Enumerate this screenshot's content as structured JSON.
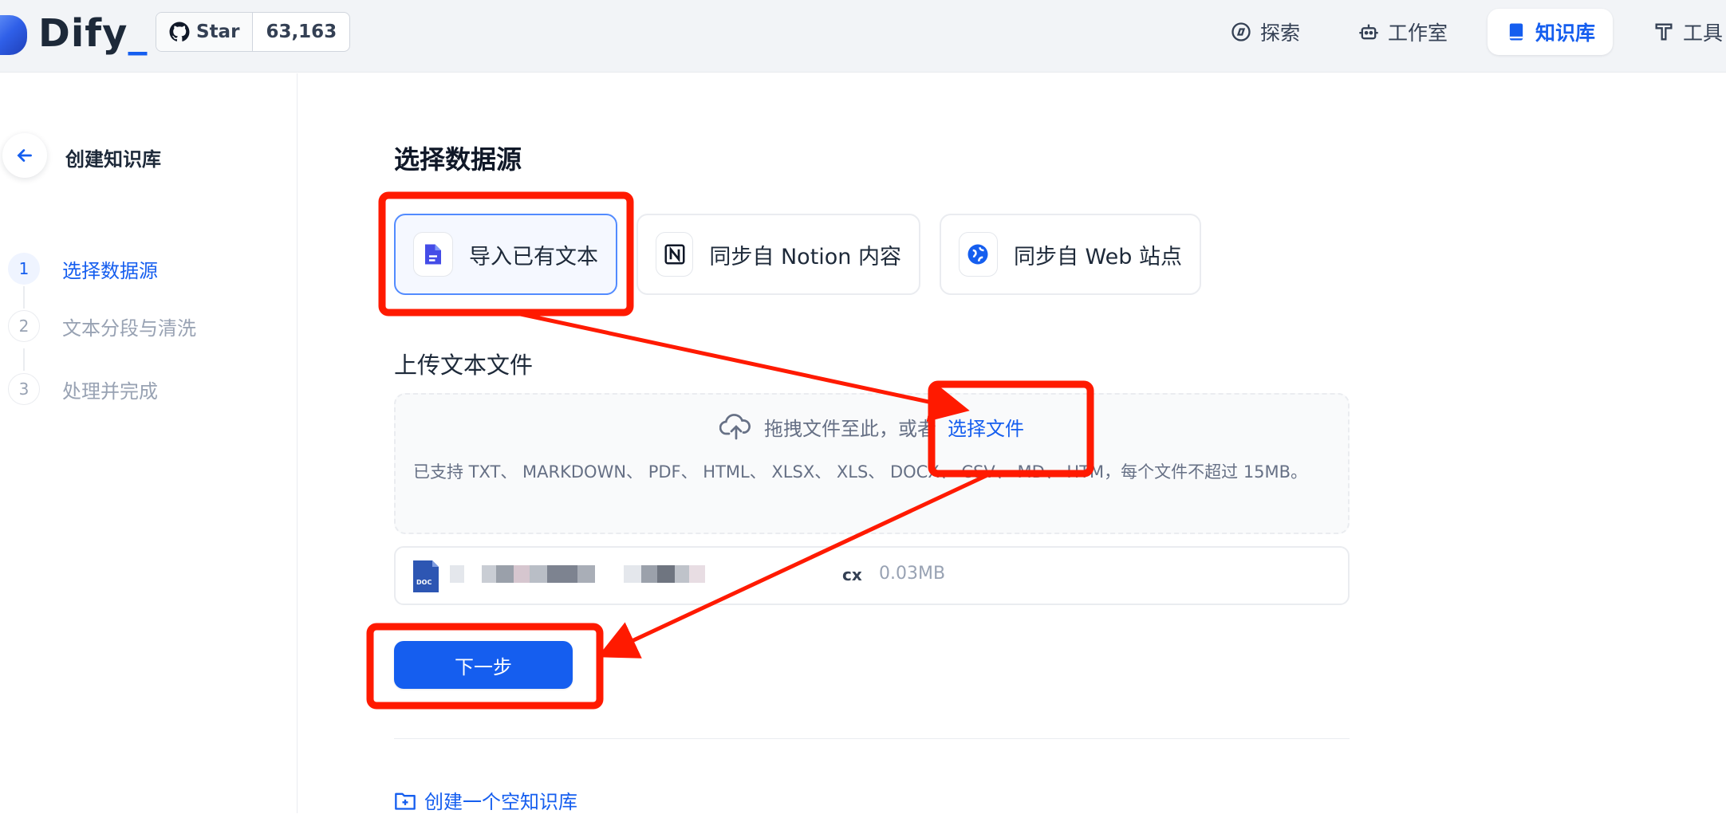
{
  "brand": {
    "name": "Dify",
    "dot": "_"
  },
  "github": {
    "star_label": "Star",
    "count": "63,163"
  },
  "nav": [
    {
      "label": "探索",
      "icon": "compass-icon"
    },
    {
      "label": "工作室",
      "icon": "robot-icon"
    },
    {
      "label": "知识库",
      "icon": "book-icon",
      "active": true
    },
    {
      "label": "工具",
      "icon": "hammer-icon"
    }
  ],
  "sidebar": {
    "title": "创建知识库",
    "steps": [
      {
        "num": "1",
        "label": "选择数据源",
        "active": true
      },
      {
        "num": "2",
        "label": "文本分段与清洗",
        "active": false
      },
      {
        "num": "3",
        "label": "处理并完成",
        "active": false
      }
    ]
  },
  "main": {
    "title": "选择数据源",
    "sources": [
      {
        "label": "导入已有文本",
        "active": true,
        "icon": "file-icon"
      },
      {
        "label": "同步自 Notion 内容",
        "active": false,
        "icon": "notion-icon"
      },
      {
        "label": "同步自 Web 站点",
        "active": false,
        "icon": "web-icon"
      }
    ],
    "upload_label": "上传文本文件",
    "dropzone": {
      "text": "拖拽文件至此，或者",
      "link": "选择文件",
      "hint": "已支持 TXT、 MARKDOWN、 PDF、 HTML、 XLSX、 XLS、 DOCX、 CSV、 MD、 HTM，每个文件不超过 15MB。"
    },
    "file": {
      "ext": "cx",
      "size": "0.03MB",
      "icon_label": "DOC"
    },
    "next_label": "下一步",
    "create_empty_label": "创建一个空知识库"
  },
  "colors": {
    "accent": "#155eef",
    "annotation": "#ff1a00"
  }
}
